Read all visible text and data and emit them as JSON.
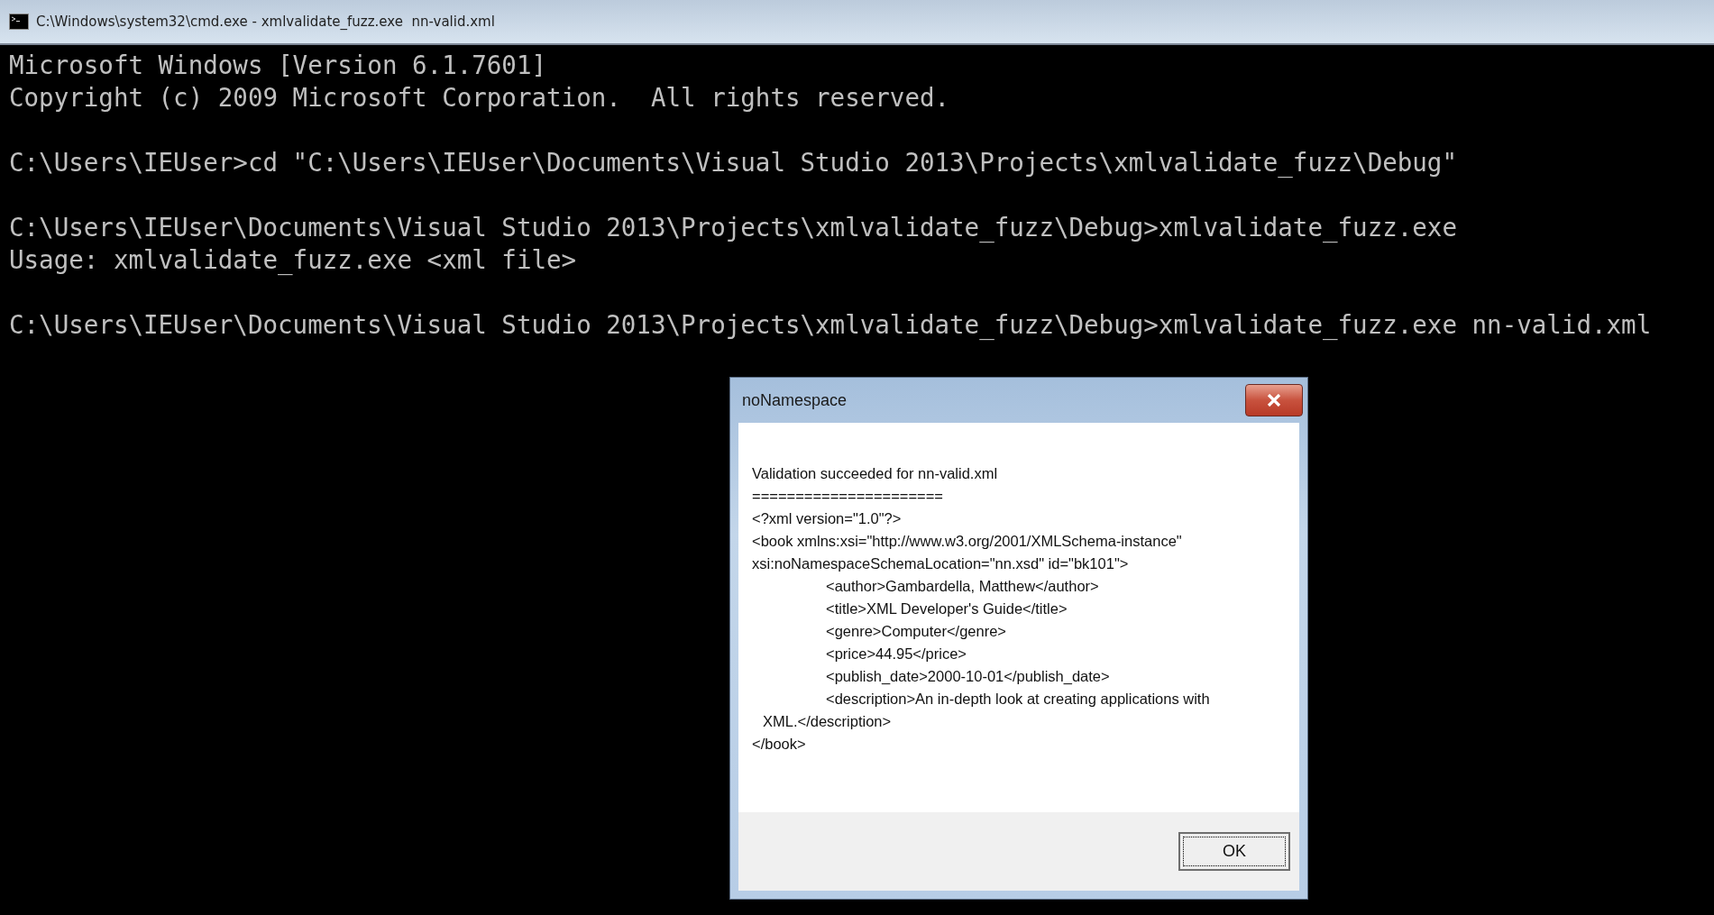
{
  "window": {
    "title": "C:\\Windows\\system32\\cmd.exe - xmlvalidate_fuzz.exe  nn-valid.xml"
  },
  "console": {
    "blocks": [
      [
        "Microsoft Windows [Version 6.1.7601]",
        "Copyright (c) 2009 Microsoft Corporation.  All rights reserved."
      ],
      [
        "C:\\Users\\IEUser>cd \"C:\\Users\\IEUser\\Documents\\Visual Studio 2013\\Projects\\xmlvalidate_fuzz\\Debug\""
      ],
      [
        "C:\\Users\\IEUser\\Documents\\Visual Studio 2013\\Projects\\xmlvalidate_fuzz\\Debug>xmlvalidate_fuzz.exe",
        "Usage: xmlvalidate_fuzz.exe <xml file>"
      ],
      [
        "C:\\Users\\IEUser\\Documents\\Visual Studio 2013\\Projects\\xmlvalidate_fuzz\\Debug>xmlvalidate_fuzz.exe nn-valid.xml"
      ]
    ]
  },
  "dialog": {
    "title": "noNamespace",
    "lines": [
      {
        "kind": "plain",
        "text": "Validation succeeded for nn-valid.xml"
      },
      {
        "kind": "plain",
        "text": "======================"
      },
      {
        "kind": "plain",
        "text": "<?xml version=\"1.0\"?>"
      },
      {
        "kind": "plain",
        "text": "<book xmlns:xsi=\"http://www.w3.org/2001/XMLSchema-instance\""
      },
      {
        "kind": "plain",
        "text": "xsi:noNamespaceSchemaLocation=\"nn.xsd\" id=\"bk101\">"
      },
      {
        "kind": "indented",
        "text": "<author>Gambardella, Matthew</author>"
      },
      {
        "kind": "indented",
        "text": "<title>XML Developer's Guide</title>"
      },
      {
        "kind": "indented",
        "text": "<genre>Computer</genre>"
      },
      {
        "kind": "indented",
        "text": "<price>44.95</price>"
      },
      {
        "kind": "indented",
        "text": "<publish_date>2000-10-01</publish_date>"
      },
      {
        "kind": "indented",
        "text": "<description>An in-depth look at creating applications with"
      },
      {
        "kind": "continuation",
        "text": "XML.</description>"
      },
      {
        "kind": "plain",
        "text": "</book>"
      }
    ],
    "buttons": [
      {
        "label": "OK",
        "focused": true
      }
    ]
  }
}
